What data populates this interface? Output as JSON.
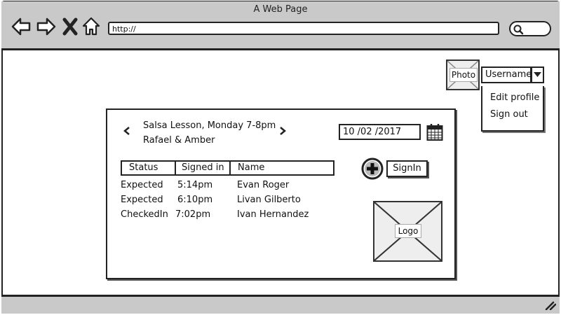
{
  "browser": {
    "title": "A Web Page",
    "url": "http://"
  },
  "user": {
    "photo_label": "Photo",
    "username": "Username",
    "menu": [
      "Edit profile",
      "Sign out"
    ]
  },
  "lesson": {
    "title": "Salsa Lesson, Monday 7-8pm",
    "instructors": "Rafael & Amber",
    "date": "10 /02 /2017",
    "signin_label": "SignIn",
    "logo_label": "Logo"
  },
  "table": {
    "headers": [
      "Status",
      "Signed in",
      "Name"
    ],
    "rows": [
      [
        "Expected",
        "5:14pm",
        "Evan Roger"
      ],
      [
        "Expected",
        "6:10pm",
        "Livan Gilberto"
      ],
      [
        "CheckedIn",
        "7:02pm",
        "Ivan Hernandez"
      ]
    ]
  }
}
